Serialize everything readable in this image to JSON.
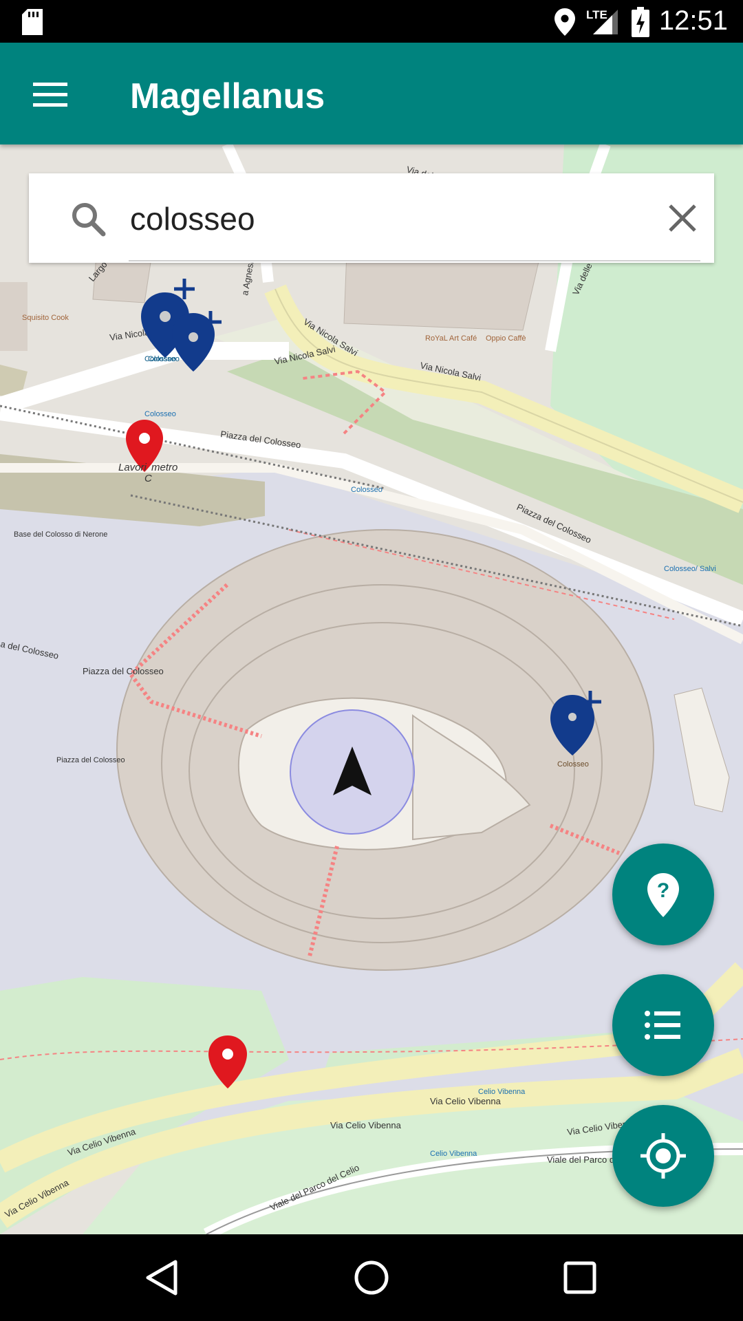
{
  "status": {
    "time": "12:51",
    "network": "LTE"
  },
  "app": {
    "title": "Magellanus"
  },
  "search": {
    "value": "colosseo"
  },
  "map": {
    "streets": [
      "Via del M",
      "Via Nicola Salvi",
      "Via Nicola Salvi",
      "Via Nicola Salvi",
      "Via Nicola Salvi",
      "Piazza del Colosseo",
      "Piazza del Colosseo",
      "Piazza del Colosseo",
      "Via Celio Vibenna",
      "Via Celio Vibenna",
      "Via Celio Vibenna",
      "Via Celio Vibenna",
      "Via Celio Vibenna",
      "Viale del Parco del",
      "Viale del Parco del Celio",
      "Via delle",
      "a del Colosseo",
      "Largo G",
      "a Agnesi"
    ],
    "pois": [
      "Squisito Cook",
      "RoYaL Art Café",
      "Oppio Caffè",
      "Colosseo",
      "Colosseo",
      "Colosseo",
      "Colosseo/ Salvi",
      "Celio Vibenna",
      "Celio Vibenna",
      "Base del Colosso di Nerone",
      "Piazza del Colosseo"
    ],
    "marker_labels": {
      "metro_line": "C",
      "metro_prefix": "Lavori",
      "metro_suffix": "metro",
      "colosseo_pin": "Colosseo",
      "bus_pin": "Colosseo"
    }
  },
  "accent_color": "#00837e",
  "marker_colors": {
    "red": "#e0181f",
    "blue": "#123b8c"
  },
  "icons": {
    "menu": "hamburger-menu-icon",
    "search": "search-icon",
    "clear": "close-icon",
    "help": "place-help-icon",
    "list": "list-icon",
    "locate": "my-location-icon",
    "back": "back-triangle-icon",
    "home": "home-circle-icon",
    "recents": "recents-square-icon"
  }
}
